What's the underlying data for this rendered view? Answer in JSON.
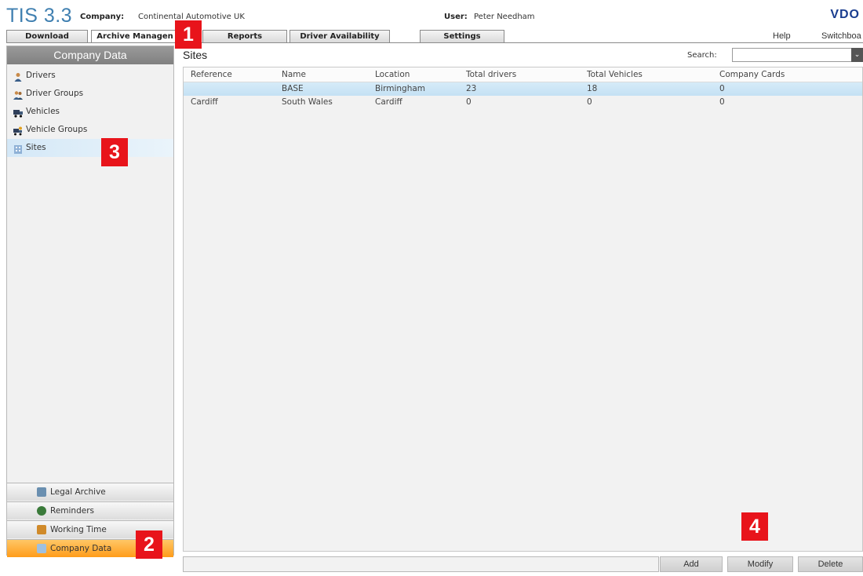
{
  "header": {
    "logo": "TIS 3.3",
    "company_label": "Company:",
    "company_value": "Continental Automotive UK",
    "user_label": "User:",
    "user_value": "Peter Needham",
    "brand": "VDO",
    "links": [
      "Help",
      "Switchboa"
    ]
  },
  "tabs": [
    "Download",
    "Archive Managen",
    "Reports",
    "Driver Availability",
    "Settings"
  ],
  "callouts": [
    "1",
    "2",
    "3",
    "4"
  ],
  "sidebar": {
    "title": "Company Data",
    "items": [
      "Drivers",
      "Driver Groups",
      "Vehicles",
      "Vehicle Groups",
      "Sites"
    ],
    "sections": [
      "Legal Archive",
      "Reminders",
      "Working Time",
      "Company Data"
    ]
  },
  "main": {
    "title": "Sites",
    "search_label": "Search:",
    "search_value": "",
    "search_dropdown": "⌄",
    "columns": [
      "Reference",
      "Name",
      "Location",
      "Total drivers",
      "Total Vehicles",
      "Company Cards"
    ],
    "rows": [
      [
        "",
        "BASE",
        "Birmingham",
        "23",
        "18",
        "0"
      ],
      [
        "Cardiff",
        "South Wales",
        "Cardiff",
        "0",
        "0",
        "0"
      ]
    ],
    "buttons": [
      "Add",
      "Modify",
      "Delete"
    ]
  },
  "colors": {
    "accent_orange": "#ff9c1a",
    "selection_blue": "#c4e1f4",
    "callout_red": "#e8141b",
    "brand_blue": "#1a3d8f"
  }
}
